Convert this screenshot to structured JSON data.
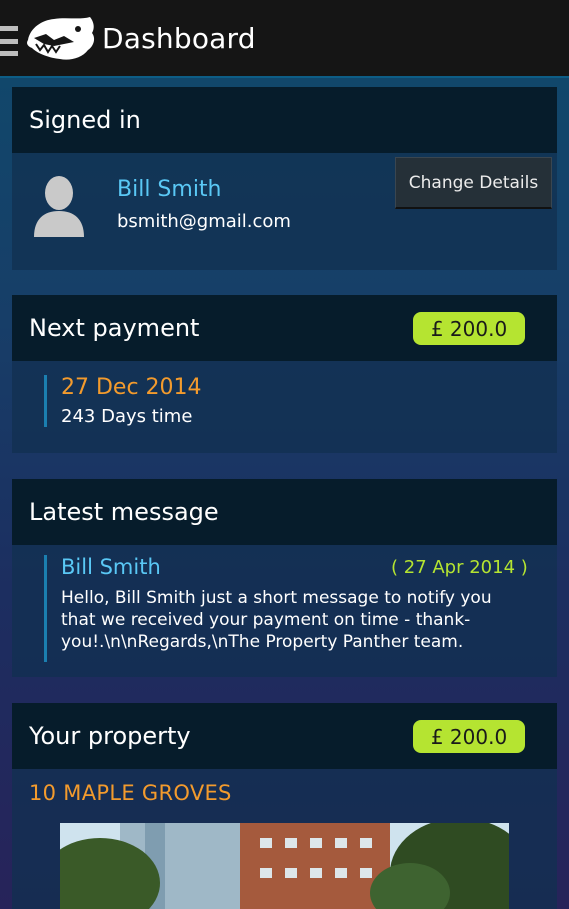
{
  "header": {
    "title": "Dashboard",
    "menu_icon": "hamburger-icon",
    "logo": "panther-logo"
  },
  "signed_in": {
    "title": "Signed in",
    "name": "Bill Smith",
    "email": "bsmith@gmail.com",
    "button": "Change Details"
  },
  "next_payment": {
    "title": "Next payment",
    "amount": "£ 200.0",
    "date": "27 Dec 2014",
    "days": "243 Days time"
  },
  "latest_message": {
    "title": "Latest message",
    "from": "Bill Smith",
    "date": "( 27 Apr 2014 )",
    "body": "Hello, Bill Smith just a short message to notify you that we received your payment on time - thank-you!.\\n\\nRegards,\\nThe Property Panther team."
  },
  "property": {
    "title": "Your property",
    "amount": "£ 200.0",
    "address": "10 MAPLE GROVES"
  },
  "colors": {
    "accent_blue": "#5ac8f5",
    "accent_orange": "#f39b2d",
    "accent_green": "#b5e431",
    "header_dark": "#061c2b"
  }
}
